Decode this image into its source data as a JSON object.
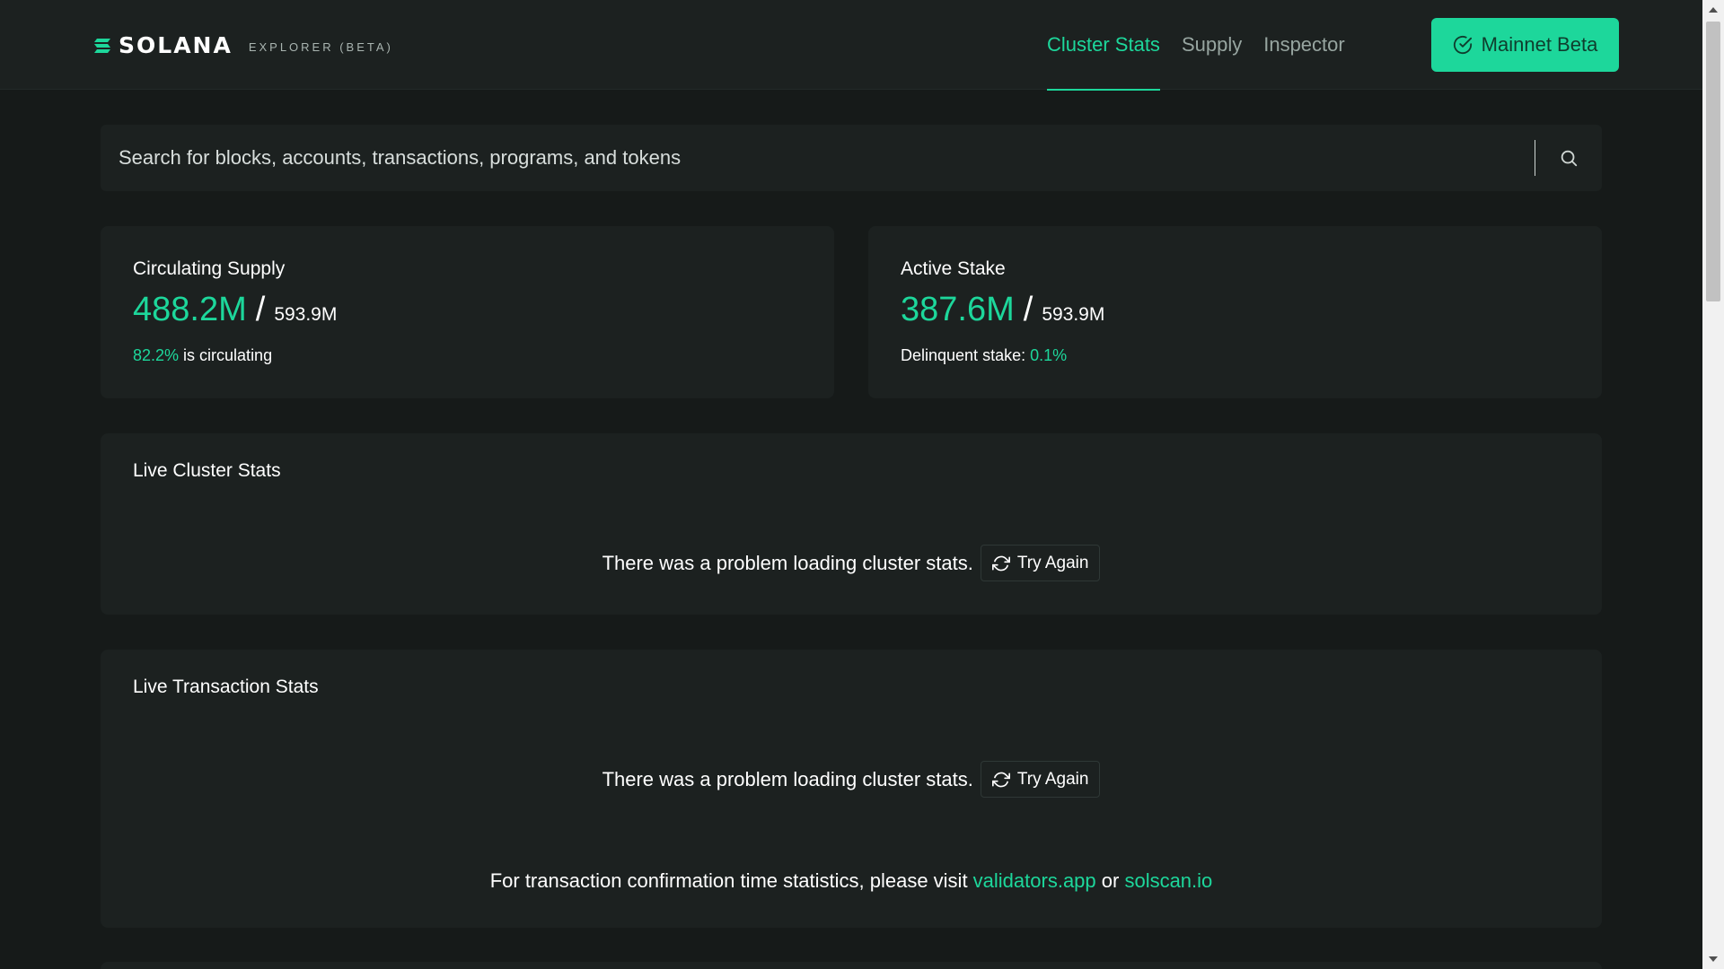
{
  "header": {
    "brand_word": "SOLANA",
    "brand_sub": "EXPLORER (BETA)",
    "nav": [
      {
        "label": "Cluster Stats",
        "active": true
      },
      {
        "label": "Supply",
        "active": false
      },
      {
        "label": "Inspector",
        "active": false
      }
    ],
    "cluster_button": "Mainnet Beta"
  },
  "search": {
    "placeholder": "Search for blocks, accounts, transactions, programs, and tokens"
  },
  "supply": {
    "title": "Circulating Supply",
    "value": "488.2M",
    "slash": "/",
    "total": "593.9M",
    "percent": "82.2%",
    "note_suffix": " is circulating"
  },
  "stake": {
    "title": "Active Stake",
    "value": "387.6M",
    "slash": "/",
    "total": "593.9M",
    "note_prefix": "Delinquent stake: ",
    "delinquent": "0.1%"
  },
  "cluster_stats": {
    "title": "Live Cluster Stats",
    "error": "There was a problem loading cluster stats.",
    "retry": "Try Again"
  },
  "tx_stats": {
    "title": "Live Transaction Stats",
    "error": "There was a problem loading cluster stats.",
    "retry": "Try Again",
    "footnote_prefix": "For transaction confirmation time statistics, please visit ",
    "link1": "validators.app",
    "or": " or ",
    "link2": "solscan.io"
  },
  "colors": {
    "accent": "#1dd79b",
    "background": "#161a19",
    "card": "#1c2120"
  }
}
